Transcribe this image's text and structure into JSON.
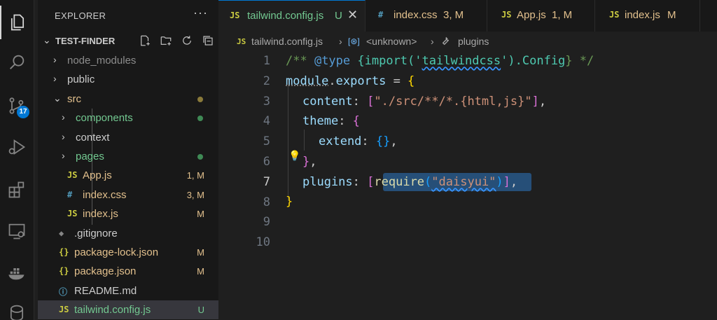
{
  "activity_bar": {
    "items": [
      {
        "icon": "explorer-icon"
      },
      {
        "icon": "search-icon"
      },
      {
        "icon": "source-control-icon",
        "badge": "17"
      },
      {
        "icon": "run-debug-icon"
      },
      {
        "icon": "extensions-icon"
      },
      {
        "icon": "remote-explorer-icon"
      },
      {
        "icon": "docker-icon"
      },
      {
        "icon": "database-icon"
      }
    ]
  },
  "sidebar": {
    "title": "EXPLORER",
    "more": "···",
    "project": "TEST-FINDER",
    "tree": [
      {
        "kind": "folder",
        "chev": "›",
        "icon": "",
        "label": "node_modules",
        "status": "",
        "dot": false
      },
      {
        "kind": "folder",
        "chev": "›",
        "icon": "",
        "label": "public",
        "status": "",
        "dot": false
      },
      {
        "kind": "folder-open",
        "chev": "⌄",
        "icon": "",
        "label": "src",
        "status": "",
        "dot": true
      },
      {
        "kind": "folder",
        "chev": "›",
        "icon": "",
        "label": "components",
        "status": "",
        "dot": true
      },
      {
        "kind": "folder",
        "chev": "›",
        "icon": "",
        "label": "context",
        "status": "",
        "dot": false
      },
      {
        "kind": "folder",
        "chev": "›",
        "icon": "",
        "label": "pages",
        "status": "",
        "dot": true
      },
      {
        "kind": "file",
        "chev": "",
        "icon": "JS",
        "label": "App.js",
        "status": "1, M",
        "dot": false
      },
      {
        "kind": "file",
        "chev": "",
        "icon": "#",
        "label": "index.css",
        "status": "3, M",
        "dot": false
      },
      {
        "kind": "file",
        "chev": "",
        "icon": "JS",
        "label": "index.js",
        "status": "M",
        "dot": false
      },
      {
        "kind": "file",
        "chev": "",
        "icon": "◆",
        "label": ".gitignore",
        "status": "",
        "dot": false
      },
      {
        "kind": "file",
        "chev": "",
        "icon": "{}",
        "label": "package-lock.json",
        "status": "M",
        "dot": false
      },
      {
        "kind": "file",
        "chev": "",
        "icon": "{}",
        "label": "package.json",
        "status": "M",
        "dot": false
      },
      {
        "kind": "file",
        "chev": "",
        "icon": "ⓘ",
        "label": "README.md",
        "status": "",
        "dot": false
      },
      {
        "kind": "file",
        "chev": "",
        "icon": "JS",
        "label": "tailwind.config.js",
        "status": "U",
        "dot": false
      }
    ]
  },
  "tabs": [
    {
      "icon": "JS",
      "name": "tailwind.config.js",
      "status": "U",
      "close": "✕",
      "active": true
    },
    {
      "icon": "#",
      "name": "index.css",
      "status": "3, M",
      "close": "",
      "active": false
    },
    {
      "icon": "JS",
      "name": "App.js",
      "status": "1, M",
      "close": "",
      "active": false
    },
    {
      "icon": "JS",
      "name": "index.js",
      "status": "M",
      "close": "",
      "active": false
    }
  ],
  "breadcrumb": {
    "file_icon": "JS",
    "file": "tailwind.config.js",
    "sep": "›",
    "symbol": "<unknown>",
    "item": "plugins"
  },
  "editor": {
    "line_numbers": [
      "1",
      "2",
      "3",
      "4",
      "5",
      "6",
      "7",
      "8",
      "9",
      "10"
    ],
    "current_line": "7",
    "code": {
      "l1_open": "/** ",
      "l1_tag": "@type",
      "l1_brace_open": " {",
      "l1_import": "import",
      "l1_paren_open": "(",
      "l1_q1": "'",
      "l1_module": "tailwindcss",
      "l1_q2": "'",
      "l1_paren_close": ").",
      "l1_config": "Config",
      "l1_close": "} */",
      "l2_module": "module",
      "l2_dot": ".",
      "l2_exports": "exports",
      "l2_eq": " = ",
      "l2_brace": "{",
      "l3_key": "content",
      "l3_colon": ": ",
      "l3_bopen": "[",
      "l3_str": "\"./src/**/*.{html,js}\"",
      "l3_bclose": "]",
      "l3_comma": ",",
      "l4_key": "theme",
      "l4_colon": ": ",
      "l4_brace": "{",
      "l5_key": "extend",
      "l5_colon": ": ",
      "l5_braces": "{}",
      "l5_comma": ",",
      "l6_brace": "}",
      "l6_comma": ",",
      "l7_key": "plugins",
      "l7_colon": ": ",
      "l7_bopen": "[",
      "l7_fn": "require",
      "l7_popen": "(",
      "l7_str": "\"daisyui\"",
      "l7_pclose": ")",
      "l7_bclose": "]",
      "l7_comma": ",",
      "l8_brace": "}"
    }
  },
  "colors": {
    "accent": "#0078d4",
    "modified": "#e2c08d",
    "untracked": "#73c991",
    "js_icon": "#cbcb41",
    "css_icon": "#519aba",
    "json_icon": "#cbcb41",
    "info_icon": "#519aba",
    "git_icon": "#858585"
  }
}
